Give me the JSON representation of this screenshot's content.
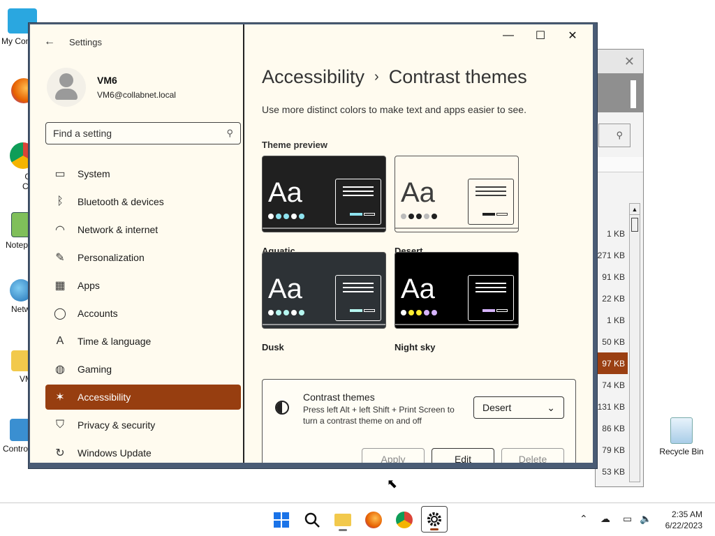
{
  "desktop": {
    "icons": [
      {
        "label": "My Com"
      },
      {
        "label": "Fire"
      },
      {
        "label": "Goo Chro"
      },
      {
        "label": "Notep"
      },
      {
        "label": "Netw"
      },
      {
        "label": "VM"
      },
      {
        "label": "Contro"
      }
    ],
    "recycle_bin": "Recycle Bin"
  },
  "bg_window": {
    "close": "✕",
    "sizes": [
      "1 KB",
      "271 KB",
      "91 KB",
      "22 KB",
      "1 KB",
      "50 KB",
      "97 KB",
      "74 KB",
      "131 KB",
      "86 KB",
      "79 KB",
      "53 KB"
    ],
    "selected_index": 6
  },
  "settings": {
    "app_title": "Settings",
    "back": "←",
    "profile": {
      "name": "VM6",
      "email": "VM6@collabnet.local"
    },
    "search_placeholder": "Find a setting",
    "nav": [
      {
        "label": "System",
        "icon": "▭"
      },
      {
        "label": "Bluetooth & devices",
        "icon": "ᛒ"
      },
      {
        "label": "Network & internet",
        "icon": "◠"
      },
      {
        "label": "Personalization",
        "icon": "✎"
      },
      {
        "label": "Apps",
        "icon": "▦"
      },
      {
        "label": "Accounts",
        "icon": "◯"
      },
      {
        "label": "Time & language",
        "icon": "A"
      },
      {
        "label": "Gaming",
        "icon": "◍"
      },
      {
        "label": "Accessibility",
        "icon": "✶"
      },
      {
        "label": "Privacy & security",
        "icon": "⛉"
      },
      {
        "label": "Windows Update",
        "icon": "↻"
      }
    ],
    "active_nav": "Accessibility",
    "breadcrumb_parent": "Accessibility",
    "breadcrumb_sep": "›",
    "breadcrumb_current": "Contrast themes",
    "subtitle": "Use more distinct colors to make text and apps easier to see.",
    "preview_header": "Theme preview",
    "themes": [
      {
        "name": "Aquatic",
        "aa": "Aa",
        "bg": "#202020",
        "fg": "#ffffff",
        "dots": [
          "#ffffff",
          "#8ee3ef",
          "#8ee3ef",
          "#ffffff",
          "#8ee3ef"
        ],
        "btn": "#8ee3ef"
      },
      {
        "name": "Desert",
        "aa": "Aa",
        "bg": "#fffaef",
        "fg": "#3d3d3d",
        "dots": [
          "#bbbbbb",
          "#202020",
          "#202020",
          "#bbbbbb",
          "#202020"
        ],
        "btn": "#202020"
      },
      {
        "name": "Dusk",
        "aa": "Aa",
        "bg": "#2d3236",
        "fg": "#ffffff",
        "dots": [
          "#ffffff",
          "#b6f6f0",
          "#b6f6f0",
          "#ffffff",
          "#b6f6f0"
        ],
        "btn": "#b6f6f0"
      },
      {
        "name": "Night sky",
        "aa": "Aa",
        "bg": "#000000",
        "fg": "#ffffff",
        "dots": [
          "#ffffff",
          "#ffee32",
          "#ffee32",
          "#d6b4fd",
          "#d6b4fd"
        ],
        "btn": "#d6b4fd"
      }
    ],
    "card": {
      "title": "Contrast themes",
      "description": "Press left Alt + left Shift + Print Screen to turn a contrast theme on and off",
      "selected": "Desert",
      "chevron": "⌄",
      "apply": "Apply",
      "edit": "Edit",
      "delete": "Delete"
    },
    "window_controls": {
      "minimize": "—",
      "maximize": "☐",
      "close": "✕"
    }
  },
  "taskbar": {
    "tray_chevron": "⌃",
    "time": "2:35 AM",
    "date": "6/22/2023"
  }
}
